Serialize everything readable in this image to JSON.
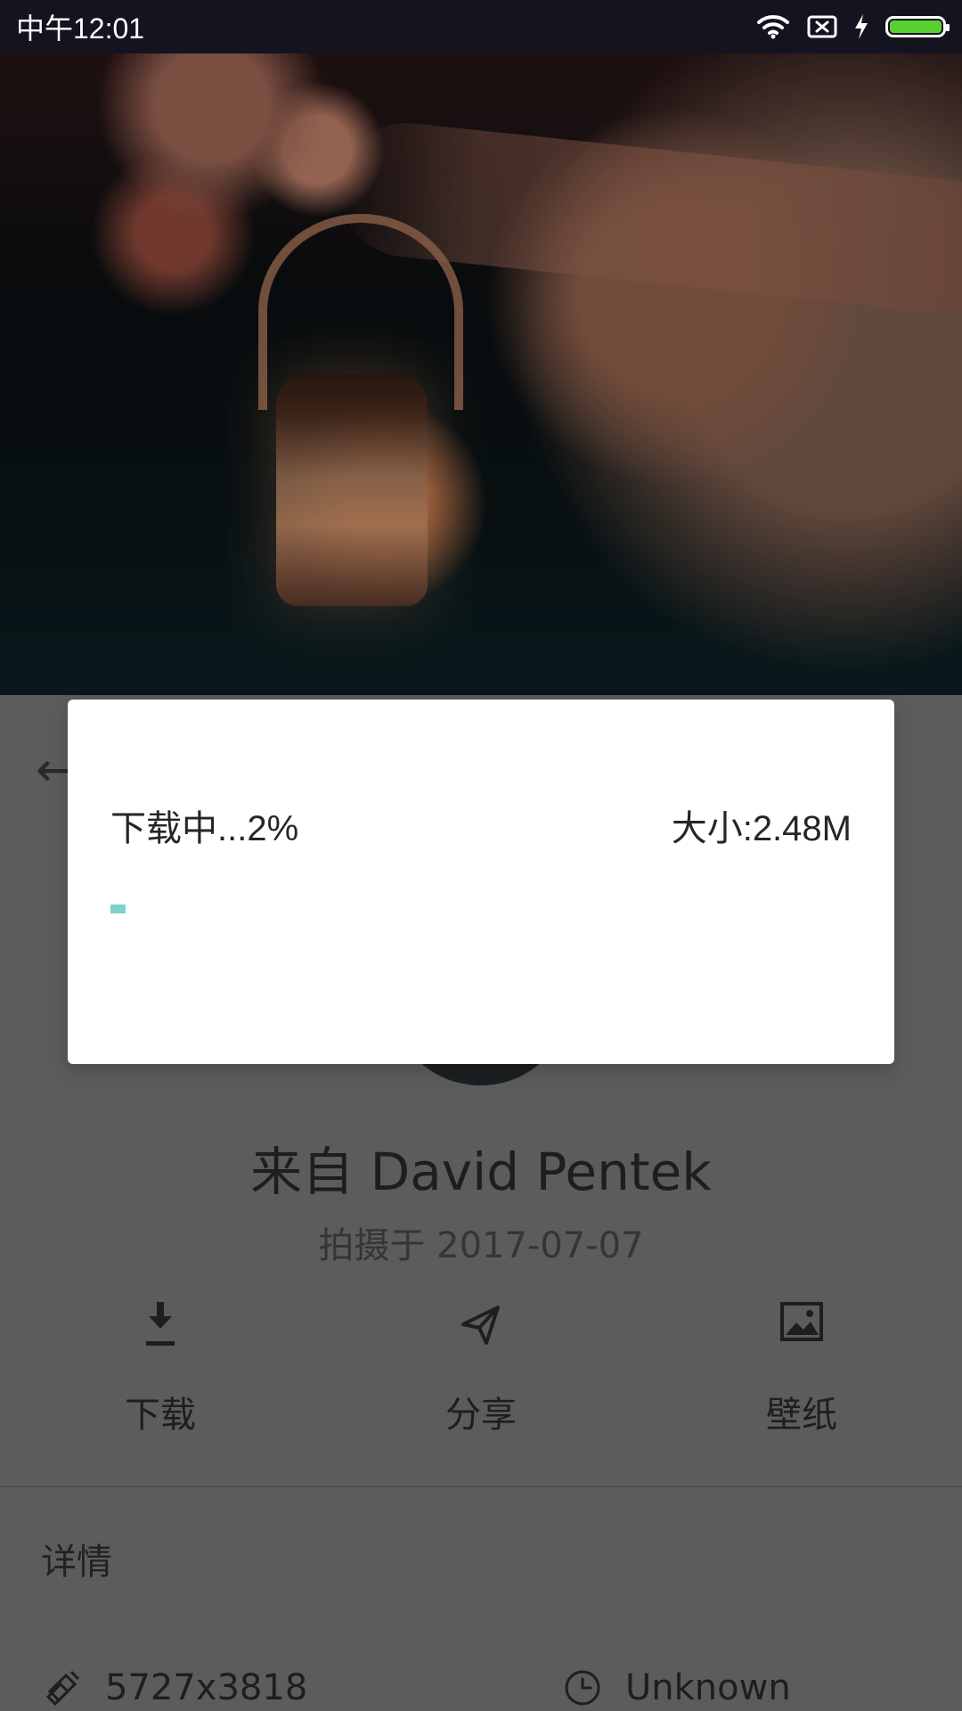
{
  "status_bar": {
    "time": "中午12:01"
  },
  "hero": {
    "icons": [
      "back-arrow-icon"
    ]
  },
  "profile": {
    "author_line": "来自 David Pentek",
    "date_line": "拍摄于 2017-07-07"
  },
  "actions": [
    {
      "label": "下载",
      "icon": "download-icon"
    },
    {
      "label": "分享",
      "icon": "send-icon"
    },
    {
      "label": "壁纸",
      "icon": "wallpaper-icon"
    }
  ],
  "details": {
    "title": "详情",
    "resolution": "5727x3818",
    "time": "Unknown"
  },
  "dialog": {
    "status": "下载中...2%",
    "size": "大小:2.48M",
    "progress_percent": 2,
    "accent": "#7ed1cc"
  },
  "colors": {
    "status_bar_bg": "#141320",
    "battery_green": "#57d130",
    "page_bg": "#676767"
  }
}
